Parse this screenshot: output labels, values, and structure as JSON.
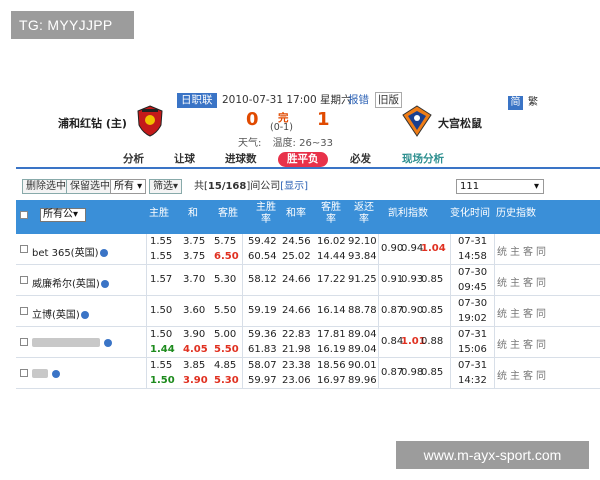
{
  "tag": "TG: MYYJJPP",
  "watermark": "www.m-ayx-sport.com",
  "match": {
    "league": "日职联",
    "datetime": "2010-07-31 17:00 星期六",
    "report": "报错",
    "old_version": "旧版",
    "home_team": "浦和红钻 (主)",
    "away_team": "大宫松鼠",
    "home_score": "0",
    "away_score": "1",
    "status": "完",
    "halftime": "(0-1)",
    "weather_label": "天气:",
    "temperature": "温度: 26~33",
    "lang_simple": "简",
    "lang_trad": "繁"
  },
  "nav": [
    "分析",
    "让球",
    "进球数",
    "胜平负",
    "必发",
    "现场分析"
  ],
  "toolbar": {
    "delete_selected": "删除选中",
    "keep_selected": "保留选中",
    "filter_all": "所有",
    "filter": "筛选",
    "count_prefix": "共[",
    "count": "15/168",
    "count_suffix": "]间公司",
    "show": "[显示]",
    "select_right": "111"
  },
  "table": {
    "headers": {
      "all_companies": "所有公",
      "home_win": "主胜",
      "draw": "和",
      "away_win": "客胜",
      "home_rate_1": "主胜",
      "home_rate_2": "率",
      "draw_rate": "和率",
      "away_rate_1": "客胜",
      "away_rate_2": "率",
      "return_1": "返还",
      "return_2": "率",
      "kelly": "凯利指数",
      "change_time": "变化时间",
      "history": "历史指数"
    },
    "rows": [
      {
        "company": "bet 365(英国)",
        "lines": [
          {
            "h": "1.55",
            "d": "3.75",
            "a": "5.75",
            "hr": "59.42",
            "dr": "24.56",
            "ar": "16.02",
            "ret": "92.10",
            "k1": "0.90",
            "k2": "0.94",
            "k3": "1.04",
            "k3c": "red"
          },
          {
            "h": "1.55",
            "d": "3.75",
            "a": "6.50",
            "ac": "red",
            "hr": "60.54",
            "dr": "25.02",
            "ar": "14.44",
            "ret": "93.84"
          }
        ],
        "time1": "07-31",
        "time2": "14:58"
      },
      {
        "company": "威廉希尔(英国)",
        "lines": [
          {
            "h": "1.57",
            "d": "3.70",
            "a": "5.30",
            "hr": "58.12",
            "dr": "24.66",
            "ar": "17.22",
            "ret": "91.25",
            "k1": "0.91",
            "k2": "0.93",
            "k3": "0.85"
          }
        ],
        "time1": "07-30",
        "time2": "09:45"
      },
      {
        "company": "立博(英国)",
        "lines": [
          {
            "h": "1.50",
            "d": "3.60",
            "a": "5.50",
            "hr": "59.19",
            "dr": "24.66",
            "ar": "16.14",
            "ret": "88.78",
            "k1": "0.87",
            "k2": "0.90",
            "k3": "0.85"
          }
        ],
        "time1": "07-30",
        "time2": "19:02"
      },
      {
        "company": "",
        "lines": [
          {
            "h": "1.50",
            "d": "3.90",
            "a": "5.00",
            "hr": "59.36",
            "dr": "22.83",
            "ar": "17.81",
            "ret": "89.04",
            "k1": "0.84",
            "k2": "1.01",
            "k2c": "red",
            "k3": "0.88"
          },
          {
            "h": "1.44",
            "hc": "green",
            "d": "4.05",
            "dc": "red",
            "a": "5.50",
            "ac": "red",
            "hr": "61.83",
            "dr": "21.98",
            "ar": "16.19",
            "ret": "89.04"
          }
        ],
        "time1": "07-31",
        "time2": "15:06"
      },
      {
        "company": "",
        "lines": [
          {
            "h": "1.55",
            "d": "3.85",
            "a": "4.85",
            "hr": "58.07",
            "dr": "23.38",
            "ar": "18.56",
            "ret": "90.01",
            "k1": "0.87",
            "k2": "0.98",
            "k3": "0.85"
          },
          {
            "h": "1.50",
            "hc": "green",
            "d": "3.90",
            "dc": "red",
            "a": "5.30",
            "ac": "red",
            "hr": "59.97",
            "dr": "23.06",
            "ar": "16.97",
            "ret": "89.96"
          }
        ],
        "time1": "07-31",
        "time2": "14:32"
      }
    ],
    "history_links": [
      "统",
      "主",
      "客",
      "同"
    ]
  }
}
